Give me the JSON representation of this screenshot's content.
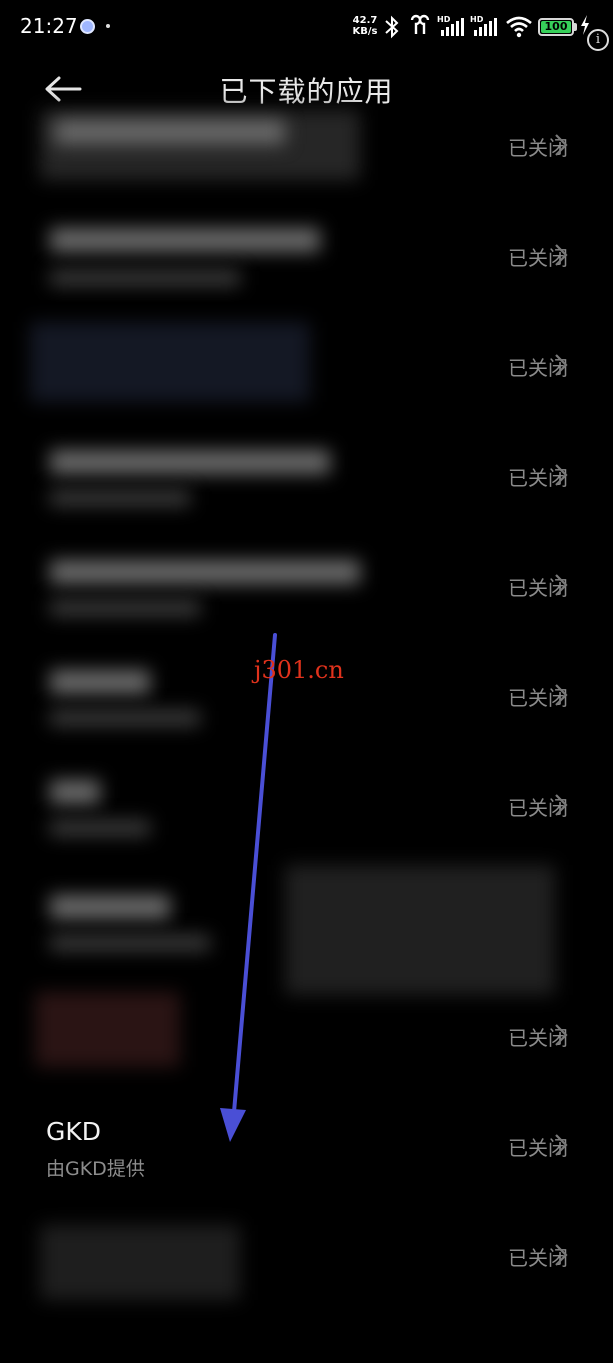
{
  "status_bar": {
    "time": "21:27",
    "net_speed_value": "42.7",
    "net_speed_unit": "KB/s",
    "battery": "100",
    "icons": [
      "notification-dot-icon",
      "bluetooth-icon",
      "earbuds-icon",
      "hd-signal-icon",
      "hd-signal-icon",
      "wifi-icon",
      "battery-icon",
      "charging-icon",
      "info-icon"
    ]
  },
  "header": {
    "back_icon": "arrow-left-icon",
    "title": "已下载的应用"
  },
  "apps": [
    {
      "name": "",
      "status": "已关闭",
      "blurred": true
    },
    {
      "name": "",
      "status": "已关闭",
      "blurred": true
    },
    {
      "name": "",
      "status": "已关闭",
      "blurred": true
    },
    {
      "name": "",
      "status": "已关闭",
      "blurred": true
    },
    {
      "name": "",
      "status": "已关闭",
      "blurred": true
    },
    {
      "name": "",
      "status": "已关闭",
      "blurred": true
    },
    {
      "name": "",
      "status": "已关闭",
      "blurred": true
    },
    {
      "name": "",
      "status": "",
      "blurred": true
    },
    {
      "name": "",
      "status": "已关闭",
      "blurred": true
    },
    {
      "name": "GKD",
      "subtitle": "由GKD提供",
      "status": "已关闭",
      "blurred": false
    },
    {
      "name": "",
      "status": "已关闭",
      "blurred": true
    }
  ],
  "watermark": "j301.cn",
  "colors": {
    "background": "#000000",
    "status_text": "#8a8a8a",
    "annotation_arrow": "#4a4fd6",
    "watermark": "#e0321c",
    "battery": "#37d05a"
  }
}
